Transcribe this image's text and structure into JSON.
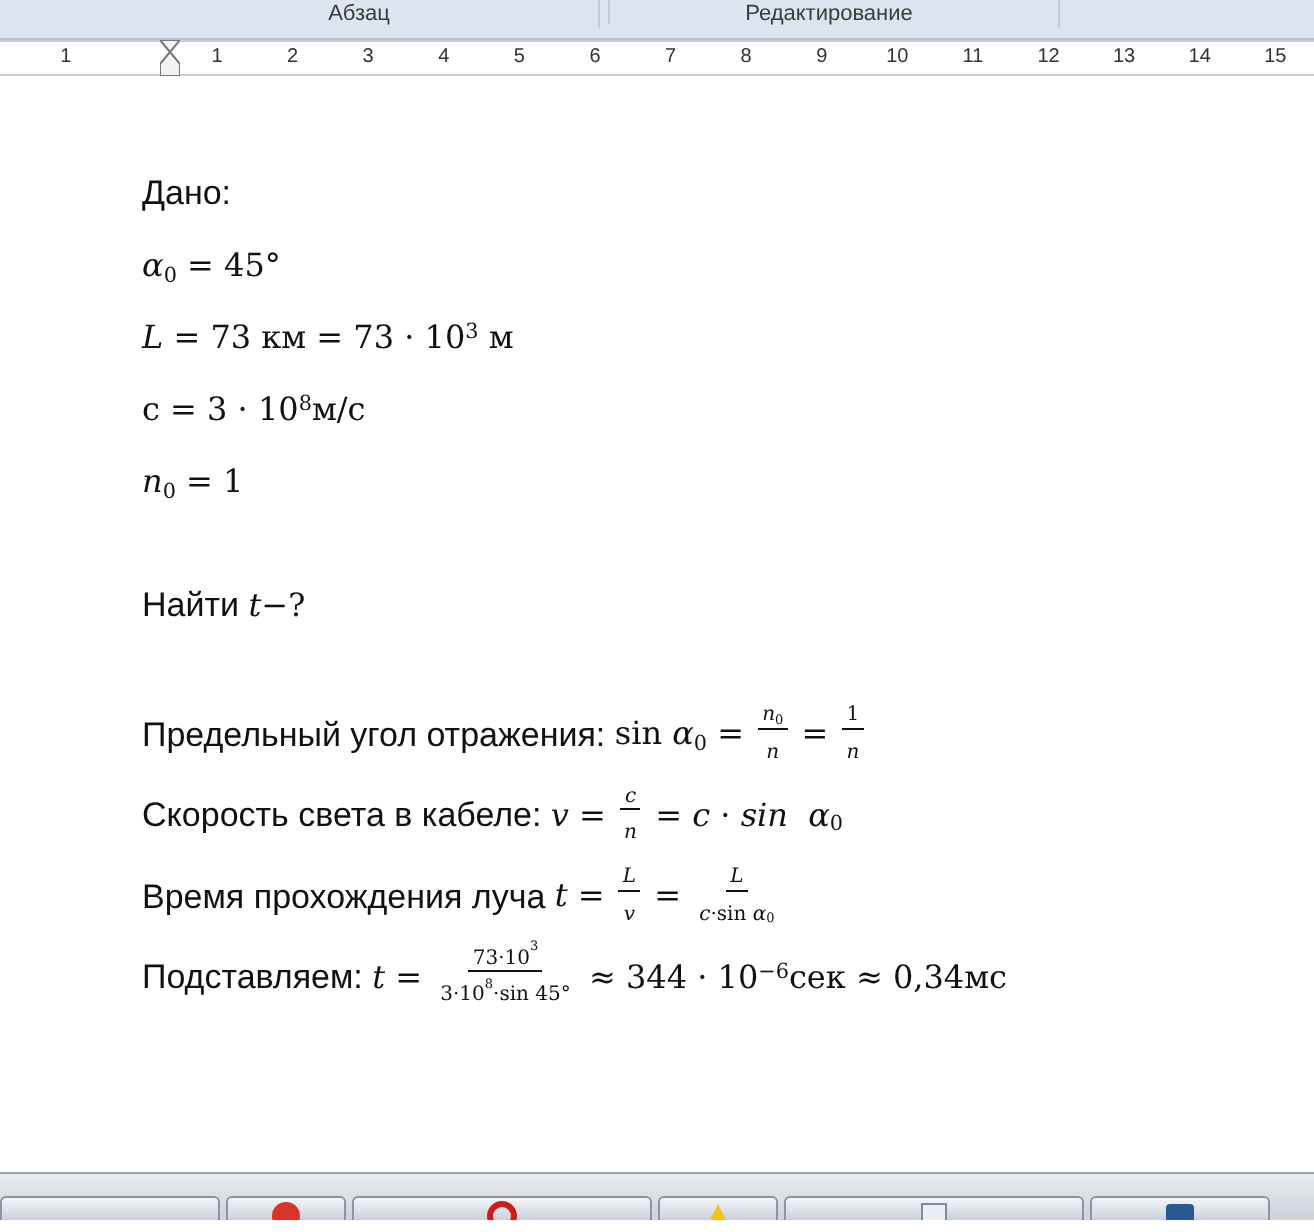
{
  "ribbon": {
    "groups": [
      {
        "label": "Абзац"
      },
      {
        "label": "Редактирование"
      }
    ]
  },
  "ruler": {
    "labels": [
      "1",
      "1",
      "2",
      "3",
      "4",
      "5",
      "6",
      "7",
      "8",
      "9",
      "10",
      "11",
      "12",
      "13",
      "14",
      "15"
    ]
  },
  "document": {
    "lines": [
      {
        "segments": [
          {
            "kind": "text",
            "text": "Дано:"
          }
        ]
      },
      {
        "segments": [
          {
            "kind": "math",
            "text": "*α*$_{0}$ = 45°"
          }
        ]
      },
      {
        "segments": [
          {
            "kind": "math",
            "text": "*L* = 73 км = 73 · 10$^{3}$ м"
          }
        ]
      },
      {
        "segments": [
          {
            "kind": "math",
            "text": "с = 3 · 10$^{8}$м/с"
          }
        ]
      },
      {
        "segments": [
          {
            "kind": "math",
            "text": "*n*$_{0}$ = 1"
          }
        ]
      },
      {
        "segments": [
          {
            "kind": "text",
            "text": "Найти "
          },
          {
            "kind": "math",
            "text": "*t*−?"
          }
        ]
      },
      {
        "segments": [
          {
            "kind": "text",
            "text": "Предельный угол отражения: "
          },
          {
            "kind": "math",
            "text": "sin *α*$_{0}$ = "
          },
          {
            "kind": "frac",
            "num": "*n*$_{0}$",
            "den": "*n*"
          },
          {
            "kind": "math",
            "text": " = "
          },
          {
            "kind": "frac",
            "num": "1",
            "den": "*n*"
          }
        ]
      },
      {
        "segments": [
          {
            "kind": "text",
            "text": "Скорость света в кабеле: "
          },
          {
            "kind": "math",
            "text": "*v* = "
          },
          {
            "kind": "frac",
            "num": "*c*",
            "den": "*n*"
          },
          {
            "kind": "math",
            "text": " = *c* · *sin  α*$_{0}$"
          }
        ]
      },
      {
        "segments": [
          {
            "kind": "text",
            "text": "Время прохождения луча "
          },
          {
            "kind": "math",
            "text": "*t* = "
          },
          {
            "kind": "frac",
            "num": "*L*",
            "den": "*v*"
          },
          {
            "kind": "math",
            "text": " = "
          },
          {
            "kind": "frac",
            "num": "*L*",
            "den": "*c*·sin *α*$_{0}$"
          }
        ]
      },
      {
        "segments": [
          {
            "kind": "text",
            "text": "Подставляем: "
          },
          {
            "kind": "math",
            "text": "*t* = "
          },
          {
            "kind": "frac",
            "num": "73·10$^{3}$",
            "den": "3·10$^{8}$·sin 45°"
          },
          {
            "kind": "math",
            "text": " ≈ 344 · 10$^{−6}$сек ≈ 0,34мс"
          }
        ]
      }
    ]
  }
}
